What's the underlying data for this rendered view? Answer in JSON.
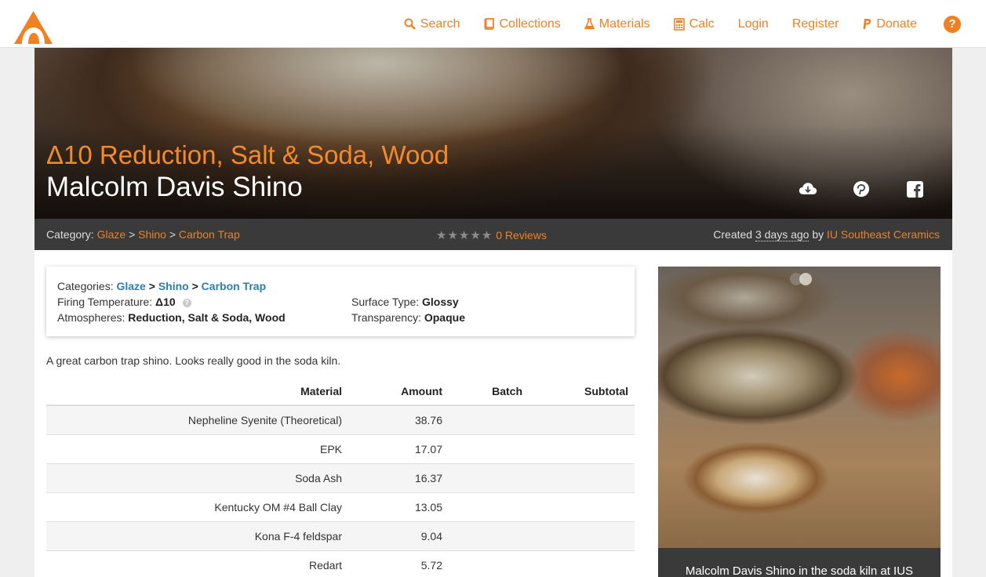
{
  "nav": {
    "items": [
      {
        "label": "Search",
        "icon": "search-icon"
      },
      {
        "label": "Collections",
        "icon": "book-icon"
      },
      {
        "label": "Materials",
        "icon": "flask-icon"
      },
      {
        "label": "Calc",
        "icon": "calculator-icon"
      },
      {
        "label": "Login"
      },
      {
        "label": "Register"
      },
      {
        "label": "Donate",
        "icon": "paypal-icon"
      }
    ],
    "help": "?"
  },
  "hero": {
    "subtitle": "Δ10 Reduction, Salt & Soda, Wood",
    "title": "Malcolm Davis Shino"
  },
  "infobar": {
    "category_label": "Category:",
    "crumbs": [
      "Glaze",
      "Shino",
      "Carbon Trap"
    ],
    "separator": ">",
    "stars": "★★★★★",
    "reviews": "0 Reviews",
    "created_label": "Created",
    "created_value": "3 days ago",
    "by_label": "by",
    "author": "IU Southeast Ceramics"
  },
  "details": {
    "categories_label": "Categories:",
    "categories": [
      "Glaze",
      "Shino",
      "Carbon Trap"
    ],
    "firing_label": "Firing Temperature:",
    "firing_value": "Δ10",
    "atmos_label": "Atmospheres:",
    "atmos_value": "Reduction, Salt & Soda, Wood",
    "surface_label": "Surface Type:",
    "surface_value": "Glossy",
    "transparency_label": "Transparency:",
    "transparency_value": "Opaque"
  },
  "description": "A great carbon trap shino. Looks really good in the soda kiln.",
  "recipe": {
    "headers": [
      "Material",
      "Amount",
      "Batch",
      "Subtotal"
    ],
    "rows": [
      {
        "material": "Nepheline Syenite (Theoretical)",
        "amount": "38.76"
      },
      {
        "material": "EPK",
        "amount": "17.07"
      },
      {
        "material": "Soda Ash",
        "amount": "16.37"
      },
      {
        "material": "Kentucky OM #4 Ball Clay",
        "amount": "13.05"
      },
      {
        "material": "Kona F-4 feldspar",
        "amount": "9.04"
      },
      {
        "material": "Redart",
        "amount": "5.72"
      }
    ]
  },
  "photo": {
    "caption": "Malcolm Davis Shino in the soda kiln at IUS"
  },
  "colors": {
    "accent": "#f08020",
    "link": "#2a7fb0",
    "bar": "#3a3a3a"
  }
}
